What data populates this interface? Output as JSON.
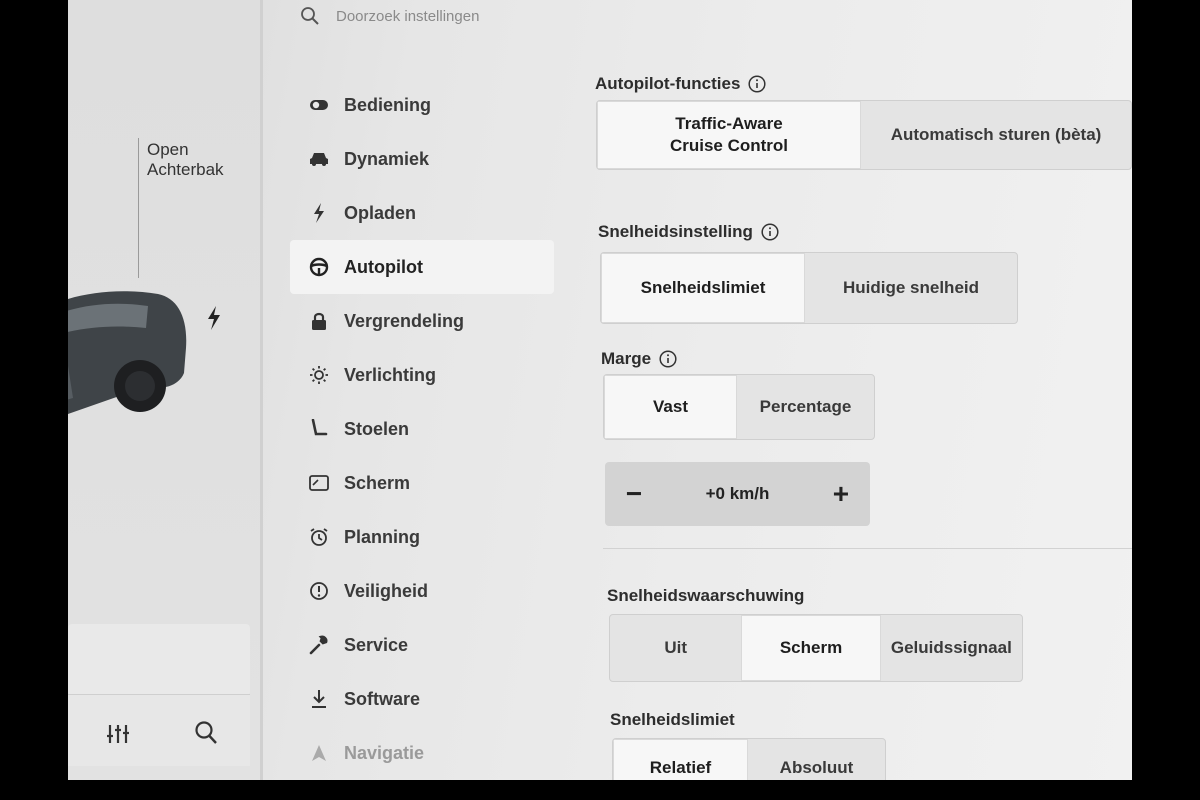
{
  "search": {
    "placeholder": "Doorzoek instellingen"
  },
  "car_panel": {
    "trunk_label_line1": "Open",
    "trunk_label_line2": "Achterbak"
  },
  "menu": {
    "items": [
      {
        "label": "Bediening",
        "icon": "toggle-icon"
      },
      {
        "label": "Dynamiek",
        "icon": "car-icon"
      },
      {
        "label": "Opladen",
        "icon": "bolt-icon"
      },
      {
        "label": "Autopilot",
        "icon": "steering-wheel-icon",
        "active": true
      },
      {
        "label": "Vergrendeling",
        "icon": "lock-icon"
      },
      {
        "label": "Verlichting",
        "icon": "sun-icon"
      },
      {
        "label": "Stoelen",
        "icon": "seat-icon"
      },
      {
        "label": "Scherm",
        "icon": "display-icon"
      },
      {
        "label": "Planning",
        "icon": "alarm-icon"
      },
      {
        "label": "Veiligheid",
        "icon": "alert-circle-icon"
      },
      {
        "label": "Service",
        "icon": "wrench-icon"
      },
      {
        "label": "Software",
        "icon": "download-icon"
      },
      {
        "label": "Navigatie",
        "icon": "navigation-icon"
      }
    ]
  },
  "autopilot_functions": {
    "title": "Autopilot-functies",
    "options": [
      "Traffic-Aware\nCruise Control",
      "Automatisch sturen (bèta)"
    ],
    "selected": 0
  },
  "speed_setting": {
    "title": "Snelheidsinstelling",
    "options": [
      "Snelheidslimiet",
      "Huidige snelheid"
    ],
    "selected": 0
  },
  "margin": {
    "title": "Marge",
    "options": [
      "Vast",
      "Percentage"
    ],
    "selected": 0,
    "stepper_value": "+0 km/h",
    "minus": "−",
    "plus": "+"
  },
  "speed_warning": {
    "title": "Snelheidswaarschuwing",
    "options": [
      "Uit",
      "Scherm",
      "Geluidssignaal"
    ],
    "selected": 1
  },
  "speed_limit": {
    "title": "Snelheidslimiet",
    "options": [
      "Relatief",
      "Absoluut"
    ],
    "selected": 0
  },
  "colors": {
    "selected_bg": "#f7f7f7",
    "segment_bg": "#e4e4e4",
    "background": "#e8e8e8"
  }
}
